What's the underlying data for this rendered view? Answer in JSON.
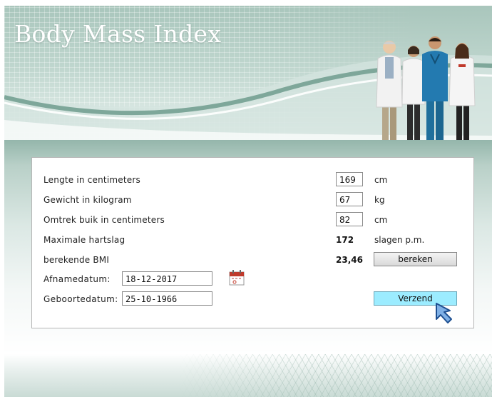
{
  "header": {
    "title": "Body Mass Index"
  },
  "form": {
    "rows": [
      {
        "label": "Lengte in centimeters",
        "value": "169",
        "unit": "cm"
      },
      {
        "label": "Gewicht in kilogram",
        "value": "67",
        "unit": "kg"
      },
      {
        "label": "Omtrek buik in centimeters",
        "value": "82",
        "unit": "cm"
      },
      {
        "label": "Maximale hartslag",
        "value": "172",
        "unit": "slagen p.m."
      },
      {
        "label": "berekende BMI",
        "value": "23,46"
      }
    ],
    "calc_button": "bereken",
    "afnamedatum_label": "Afnamedatum:",
    "afnamedatum_value": "18-12-2017",
    "geboortedatum_label": "Geboortedatum:",
    "geboortedatum_value": "25-10-1966",
    "submit_button": "Verzend",
    "calendar_icon": "calendar-icon",
    "cursor_icon": "arrow-cursor-icon"
  },
  "colors": {
    "header_teal": "#a9c6bc",
    "submit_button": "#9cecff",
    "calendar_red": "#c0392b"
  }
}
